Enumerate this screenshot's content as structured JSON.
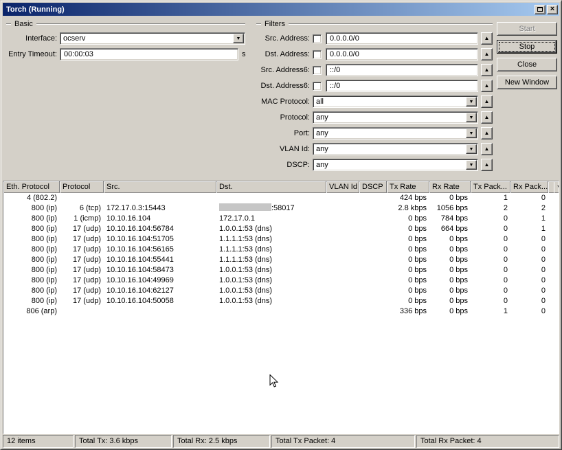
{
  "window": {
    "title": "Torch (Running)"
  },
  "colors": {
    "titlebar_start": "#0a246a",
    "titlebar_end": "#a6caf0",
    "redaction": "#c6c6c6"
  },
  "basic": {
    "legend": "Basic",
    "interface_label": "Interface:",
    "interface_value": "ocserv",
    "entry_timeout_label": "Entry Timeout:",
    "entry_timeout_value": "00:00:03",
    "entry_timeout_suffix": "s"
  },
  "filters": {
    "legend": "Filters",
    "rows": [
      {
        "id": "src-address",
        "label": "Src. Address:",
        "kind": "input",
        "value": "0.0.0.0/0",
        "checked": false
      },
      {
        "id": "dst-address",
        "label": "Dst. Address:",
        "kind": "input",
        "value": "0.0.0.0/0",
        "checked": false
      },
      {
        "id": "src-address6",
        "label": "Src. Address6:",
        "kind": "input",
        "value": "::/0",
        "checked": false
      },
      {
        "id": "dst-address6",
        "label": "Dst. Address6:",
        "kind": "input",
        "value": "::/0",
        "checked": false
      },
      {
        "id": "mac-protocol",
        "label": "MAC Protocol:",
        "kind": "combo",
        "value": "all"
      },
      {
        "id": "protocol",
        "label": "Protocol:",
        "kind": "combo",
        "value": "any"
      },
      {
        "id": "port",
        "label": "Port:",
        "kind": "combo",
        "value": "any"
      },
      {
        "id": "vlan-id",
        "label": "VLAN Id:",
        "kind": "combo",
        "value": "any"
      },
      {
        "id": "dscp",
        "label": "DSCP:",
        "kind": "combo",
        "value": "any"
      }
    ]
  },
  "actions": {
    "start": "Start",
    "stop": "Stop",
    "close": "Close",
    "new_window": "New Window"
  },
  "table": {
    "columns": [
      "Eth. Protocol",
      "Protocol",
      "Src.",
      "Dst.",
      "VLAN Id",
      "DSCP",
      "Tx Rate",
      "Rx Rate",
      "Tx Pack...",
      "Rx Pack..."
    ],
    "rows": [
      {
        "eth": "4 (802.2)",
        "proto": "",
        "src": "",
        "dst": "",
        "vlan": "",
        "dscp": "",
        "tx": "424 bps",
        "rx": "0 bps",
        "txp": "1",
        "rxp": "0"
      },
      {
        "eth": "800 (ip)",
        "proto": "6 (tcp)",
        "src": "172.17.0.3:15443",
        "dst": ":58017",
        "dst_redacted": true,
        "vlan": "",
        "dscp": "",
        "tx": "2.8 kbps",
        "rx": "1056 bps",
        "txp": "2",
        "rxp": "2"
      },
      {
        "eth": "800 (ip)",
        "proto": "1 (icmp)",
        "src": "10.10.16.104",
        "dst": "172.17.0.1",
        "vlan": "",
        "dscp": "",
        "tx": "0 bps",
        "rx": "784 bps",
        "txp": "0",
        "rxp": "1"
      },
      {
        "eth": "800 (ip)",
        "proto": "17 (udp)",
        "src": "10.10.16.104:56784",
        "dst": "1.0.0.1:53 (dns)",
        "vlan": "",
        "dscp": "",
        "tx": "0 bps",
        "rx": "664 bps",
        "txp": "0",
        "rxp": "1"
      },
      {
        "eth": "800 (ip)",
        "proto": "17 (udp)",
        "src": "10.10.16.104:51705",
        "dst": "1.1.1.1:53 (dns)",
        "vlan": "",
        "dscp": "",
        "tx": "0 bps",
        "rx": "0 bps",
        "txp": "0",
        "rxp": "0"
      },
      {
        "eth": "800 (ip)",
        "proto": "17 (udp)",
        "src": "10.10.16.104:56165",
        "dst": "1.1.1.1:53 (dns)",
        "vlan": "",
        "dscp": "",
        "tx": "0 bps",
        "rx": "0 bps",
        "txp": "0",
        "rxp": "0"
      },
      {
        "eth": "800 (ip)",
        "proto": "17 (udp)",
        "src": "10.10.16.104:55441",
        "dst": "1.1.1.1:53 (dns)",
        "vlan": "",
        "dscp": "",
        "tx": "0 bps",
        "rx": "0 bps",
        "txp": "0",
        "rxp": "0"
      },
      {
        "eth": "800 (ip)",
        "proto": "17 (udp)",
        "src": "10.10.16.104:58473",
        "dst": "1.0.0.1:53 (dns)",
        "vlan": "",
        "dscp": "",
        "tx": "0 bps",
        "rx": "0 bps",
        "txp": "0",
        "rxp": "0"
      },
      {
        "eth": "800 (ip)",
        "proto": "17 (udp)",
        "src": "10.10.16.104:49969",
        "dst": "1.0.0.1:53 (dns)",
        "vlan": "",
        "dscp": "",
        "tx": "0 bps",
        "rx": "0 bps",
        "txp": "0",
        "rxp": "0"
      },
      {
        "eth": "800 (ip)",
        "proto": "17 (udp)",
        "src": "10.10.16.104:62127",
        "dst": "1.0.0.1:53 (dns)",
        "vlan": "",
        "dscp": "",
        "tx": "0 bps",
        "rx": "0 bps",
        "txp": "0",
        "rxp": "0"
      },
      {
        "eth": "800 (ip)",
        "proto": "17 (udp)",
        "src": "10.10.16.104:50058",
        "dst": "1.0.0.1:53 (dns)",
        "vlan": "",
        "dscp": "",
        "tx": "0 bps",
        "rx": "0 bps",
        "txp": "0",
        "rxp": "0"
      },
      {
        "eth": "806 (arp)",
        "proto": "",
        "src": "",
        "dst": "",
        "vlan": "",
        "dscp": "",
        "tx": "336 bps",
        "rx": "0 bps",
        "txp": "1",
        "rxp": "0"
      }
    ]
  },
  "statusbar": {
    "items": "12 items",
    "total_tx": "Total Tx: 3.6 kbps",
    "total_rx": "Total Rx: 2.5 kbps",
    "total_tx_packet": "Total Tx Packet: 4",
    "total_rx_packet": "Total Rx Packet: 4"
  }
}
